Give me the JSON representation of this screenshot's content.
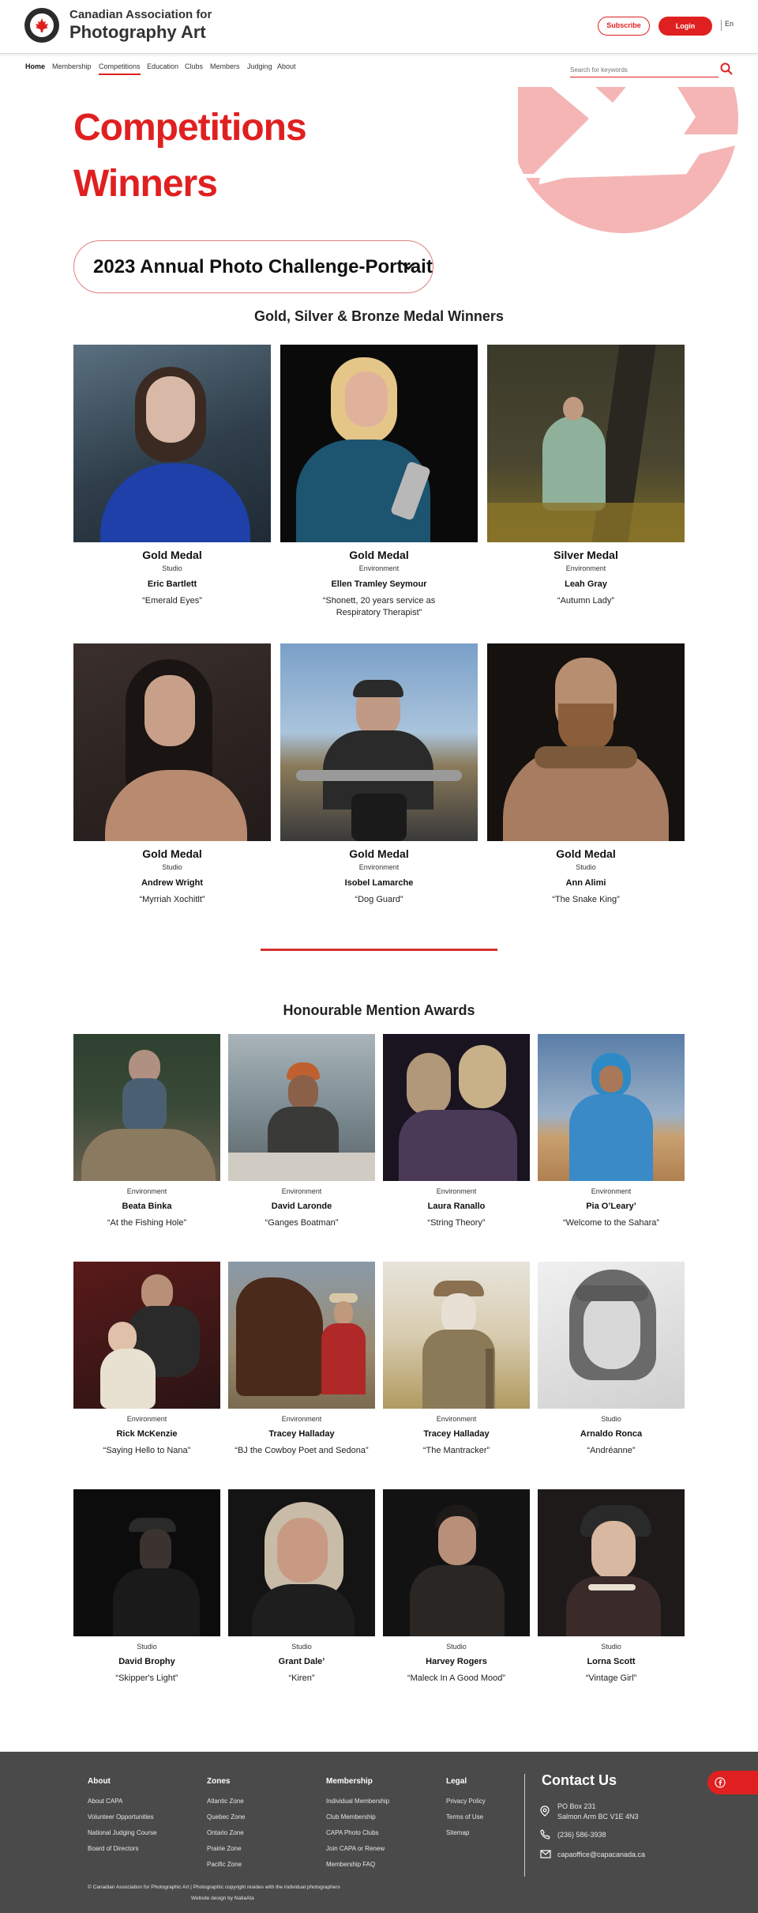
{
  "header": {
    "org_line1": "Canadian Association for",
    "org_line2": "Photography Art",
    "subscribe": "Subscribe",
    "login": "Login",
    "lang": "En"
  },
  "nav": [
    "Home",
    "Membership",
    "Competitions",
    "Education",
    "Clubs",
    "Members",
    "Judging",
    "About"
  ],
  "search": {
    "placeholder": "Search for keywords"
  },
  "page": {
    "title_line1": "Competitions",
    "title_line2": "Winners",
    "competition_select": "2023 Annual Photo Challenge-Portrait"
  },
  "medal_section": {
    "title": "Gold, Silver & Bronze Medal Winners",
    "winners": [
      {
        "medal": "Gold Medal",
        "category": "Studio",
        "name": "Eric Bartlett",
        "title": "“Emerald Eyes”"
      },
      {
        "medal": "Gold Medal",
        "category": "Environment",
        "name": "Ellen Tramley Seymour",
        "title": "“Shonett, 20 years service as Respiratory Therapist”"
      },
      {
        "medal": "Silver Medal",
        "category": "Environment",
        "name": "Leah Gray",
        "title": "“Autumn Lady”"
      },
      {
        "medal": "Gold Medal",
        "category": "Studio",
        "name": "Andrew Wright",
        "title": "“Myrriah Xochitlt”"
      },
      {
        "medal": "Gold Medal",
        "category": "Environment",
        "name": "Isobel Lamarche",
        "title": "“Dog Guard”"
      },
      {
        "medal": "Gold Medal",
        "category": "Studio",
        "name": "Ann Alimi",
        "title": "“The Snake King”"
      }
    ]
  },
  "hm_section": {
    "title": "Honourable Mention Awards",
    "winners": [
      {
        "category": "Environment",
        "name": "Beata Binka",
        "title": "“At the Fishing Hole”"
      },
      {
        "category": "Environment",
        "name": "David Laronde",
        "title": "“Ganges Boatman”"
      },
      {
        "category": "Environment",
        "name": "Laura Ranallo",
        "title": "“String Theory”"
      },
      {
        "category": "Environment",
        "name": "Pia O’Leary’",
        "title": "“Welcome to the Sahara”"
      },
      {
        "category": "Environment",
        "name": "Rick McKenzie",
        "title": "“Saying Hello to Nana”"
      },
      {
        "category": "Environment",
        "name": "Tracey Halladay",
        "title": "“BJ the Cowboy Poet and Sedona”"
      },
      {
        "category": "Environment",
        "name": "Tracey Halladay",
        "title": "“The Mantracker”"
      },
      {
        "category": "Studio",
        "name": "Arnaldo Ronca",
        "title": "“Andréanne”"
      },
      {
        "category": "Studio",
        "name": "David Brophy",
        "title": "“Skipper's Light”"
      },
      {
        "category": "Studio",
        "name": "Grant Dale’",
        "title": "“Kiren”"
      },
      {
        "category": "Studio",
        "name": "Harvey Rogers",
        "title": "“Maleck In A Good Mood”"
      },
      {
        "category": "Studio",
        "name": "Lorna Scott",
        "title": "“Vintage Girl”"
      }
    ]
  },
  "footer": {
    "about": {
      "heading": "About",
      "links": [
        "About CAPA",
        "Volunteer Opportunities",
        "National Judging Course",
        "Board of Directors"
      ]
    },
    "zones": {
      "heading": "Zones",
      "links": [
        "Atlantic Zone",
        "Quebec Zone",
        "Ontario Zone",
        "Prairie Zone",
        "Pacific Zone"
      ]
    },
    "membership": {
      "heading": "Membership",
      "links": [
        "Individual Membership",
        "Club Membership",
        "CAPA Photo Clubs",
        "Join CAPA or Renew",
        "Membership FAQ"
      ]
    },
    "legal": {
      "heading": "Legal",
      "links": [
        "Privacy Policy",
        "Terms of Use",
        "Sitemap"
      ]
    },
    "contact": {
      "heading": "Contact Us",
      "address1": "PO Box 231",
      "address2": "Salmon Arm BC V1E 4N3",
      "phone": "(236) 586-3938",
      "email": "capaoffice@capacanada.ca"
    },
    "copyright": "© Canadian Association for Photographic Art | Photographic copyright resides with the individual photographers",
    "credit": "Website design by NatiaAta"
  },
  "colors": {
    "accent": "#e02020",
    "footer_bg": "#4a4a4a",
    "aperture_pink": "#f5b5b5"
  }
}
